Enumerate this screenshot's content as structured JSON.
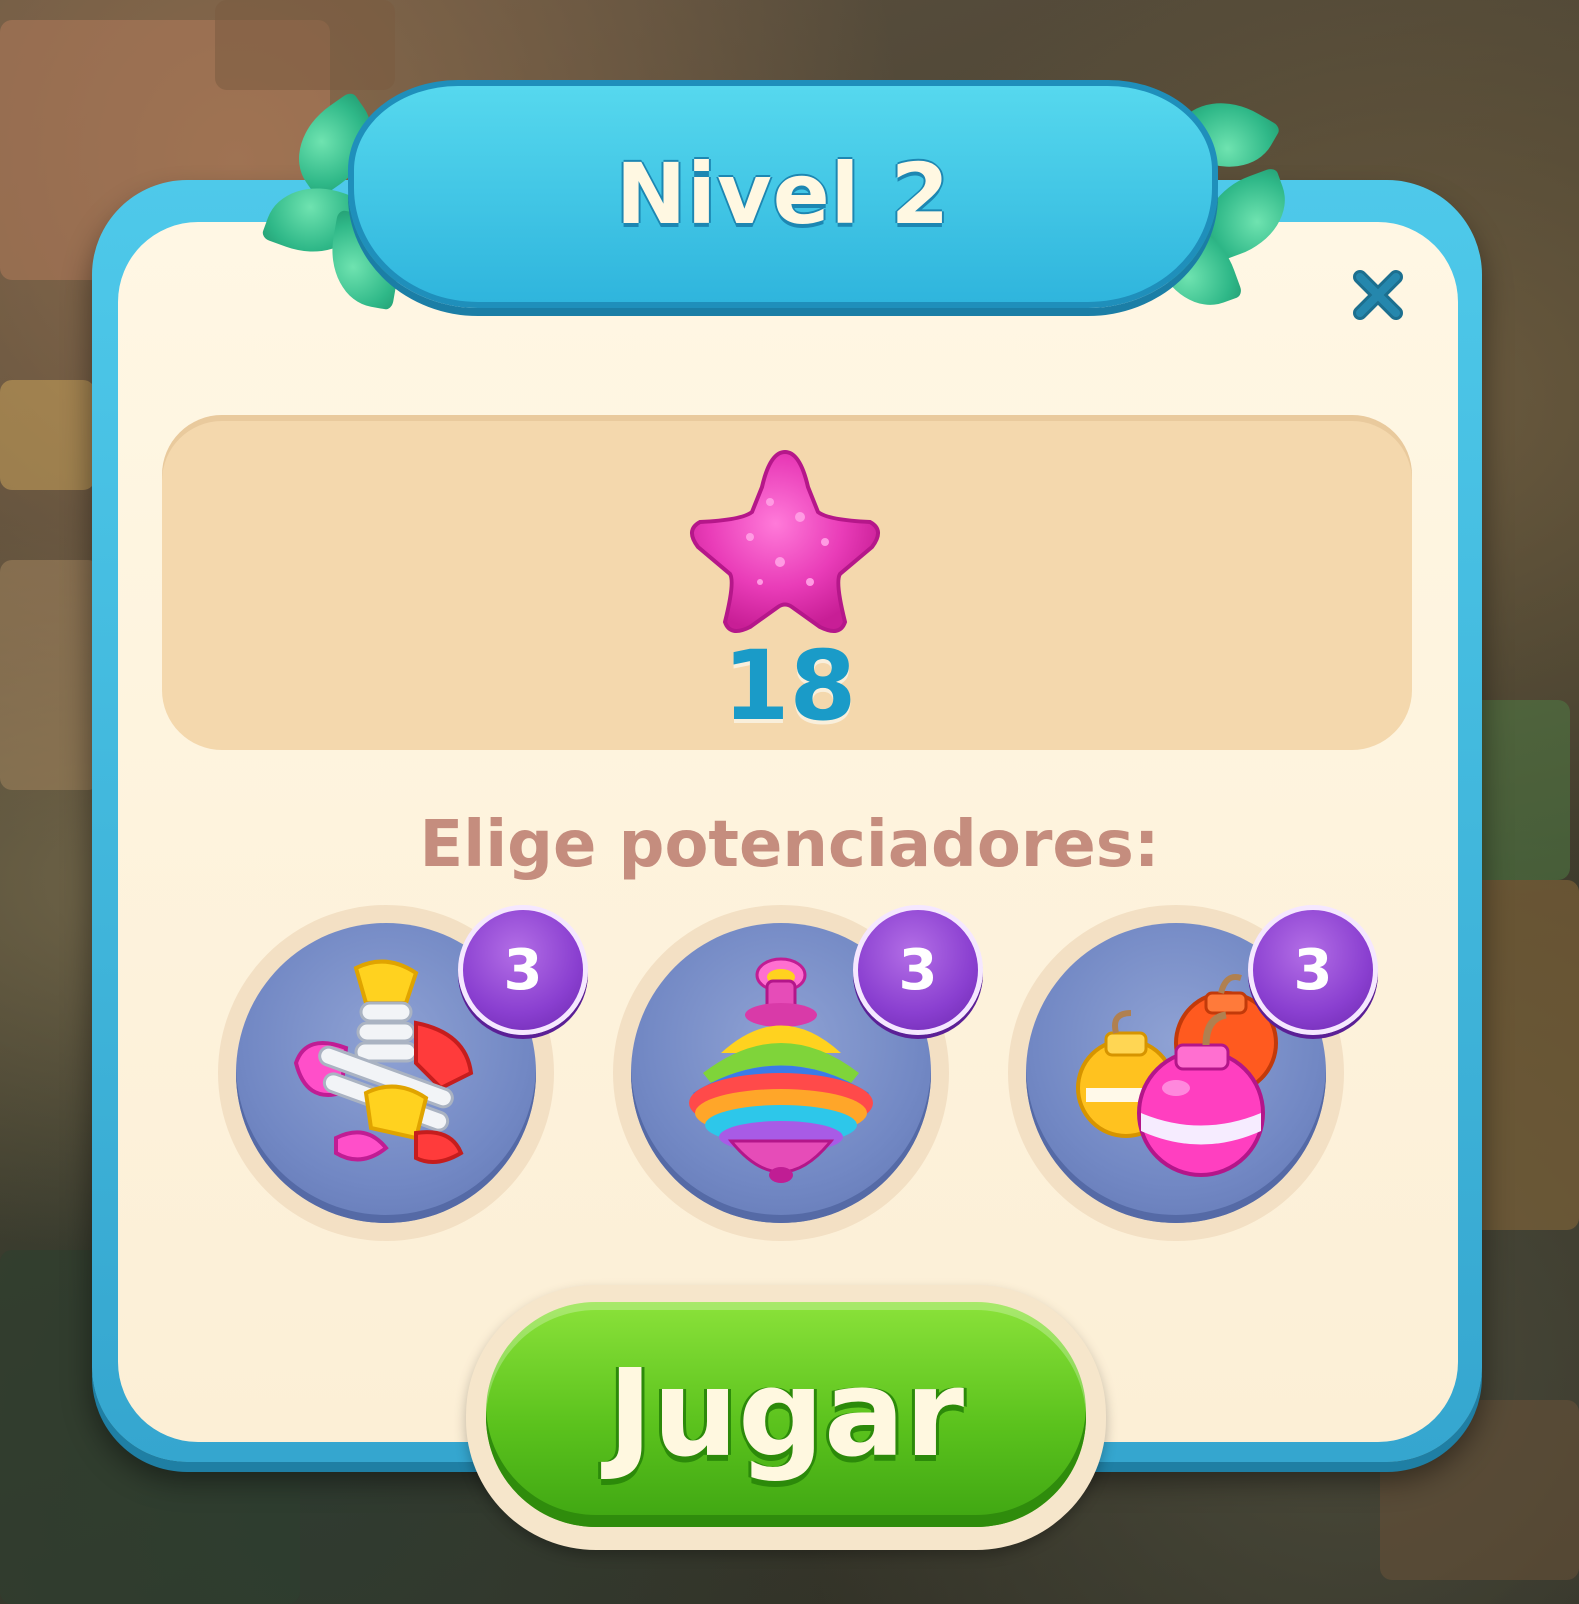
{
  "dialog": {
    "title": "Nivel 2",
    "goal": {
      "icon": "pink-star-icon",
      "count": "18"
    },
    "boosters_label": "Elige potenciadores:",
    "boosters": [
      {
        "icon": "firework-rocket-icon",
        "count": "3"
      },
      {
        "icon": "spinning-top-icon",
        "count": "3"
      },
      {
        "icon": "bombs-icon",
        "count": "3"
      }
    ],
    "play_label": "Jugar",
    "close_icon": "close-icon"
  },
  "colors": {
    "panel_blue": "#35a6cf",
    "panel_cream": "#fcefd6",
    "goal_count": "#1a9bc8",
    "boosters_label": "#c58d7e",
    "badge_purple": "#8a3fd0",
    "play_green": "#5bc21d"
  }
}
